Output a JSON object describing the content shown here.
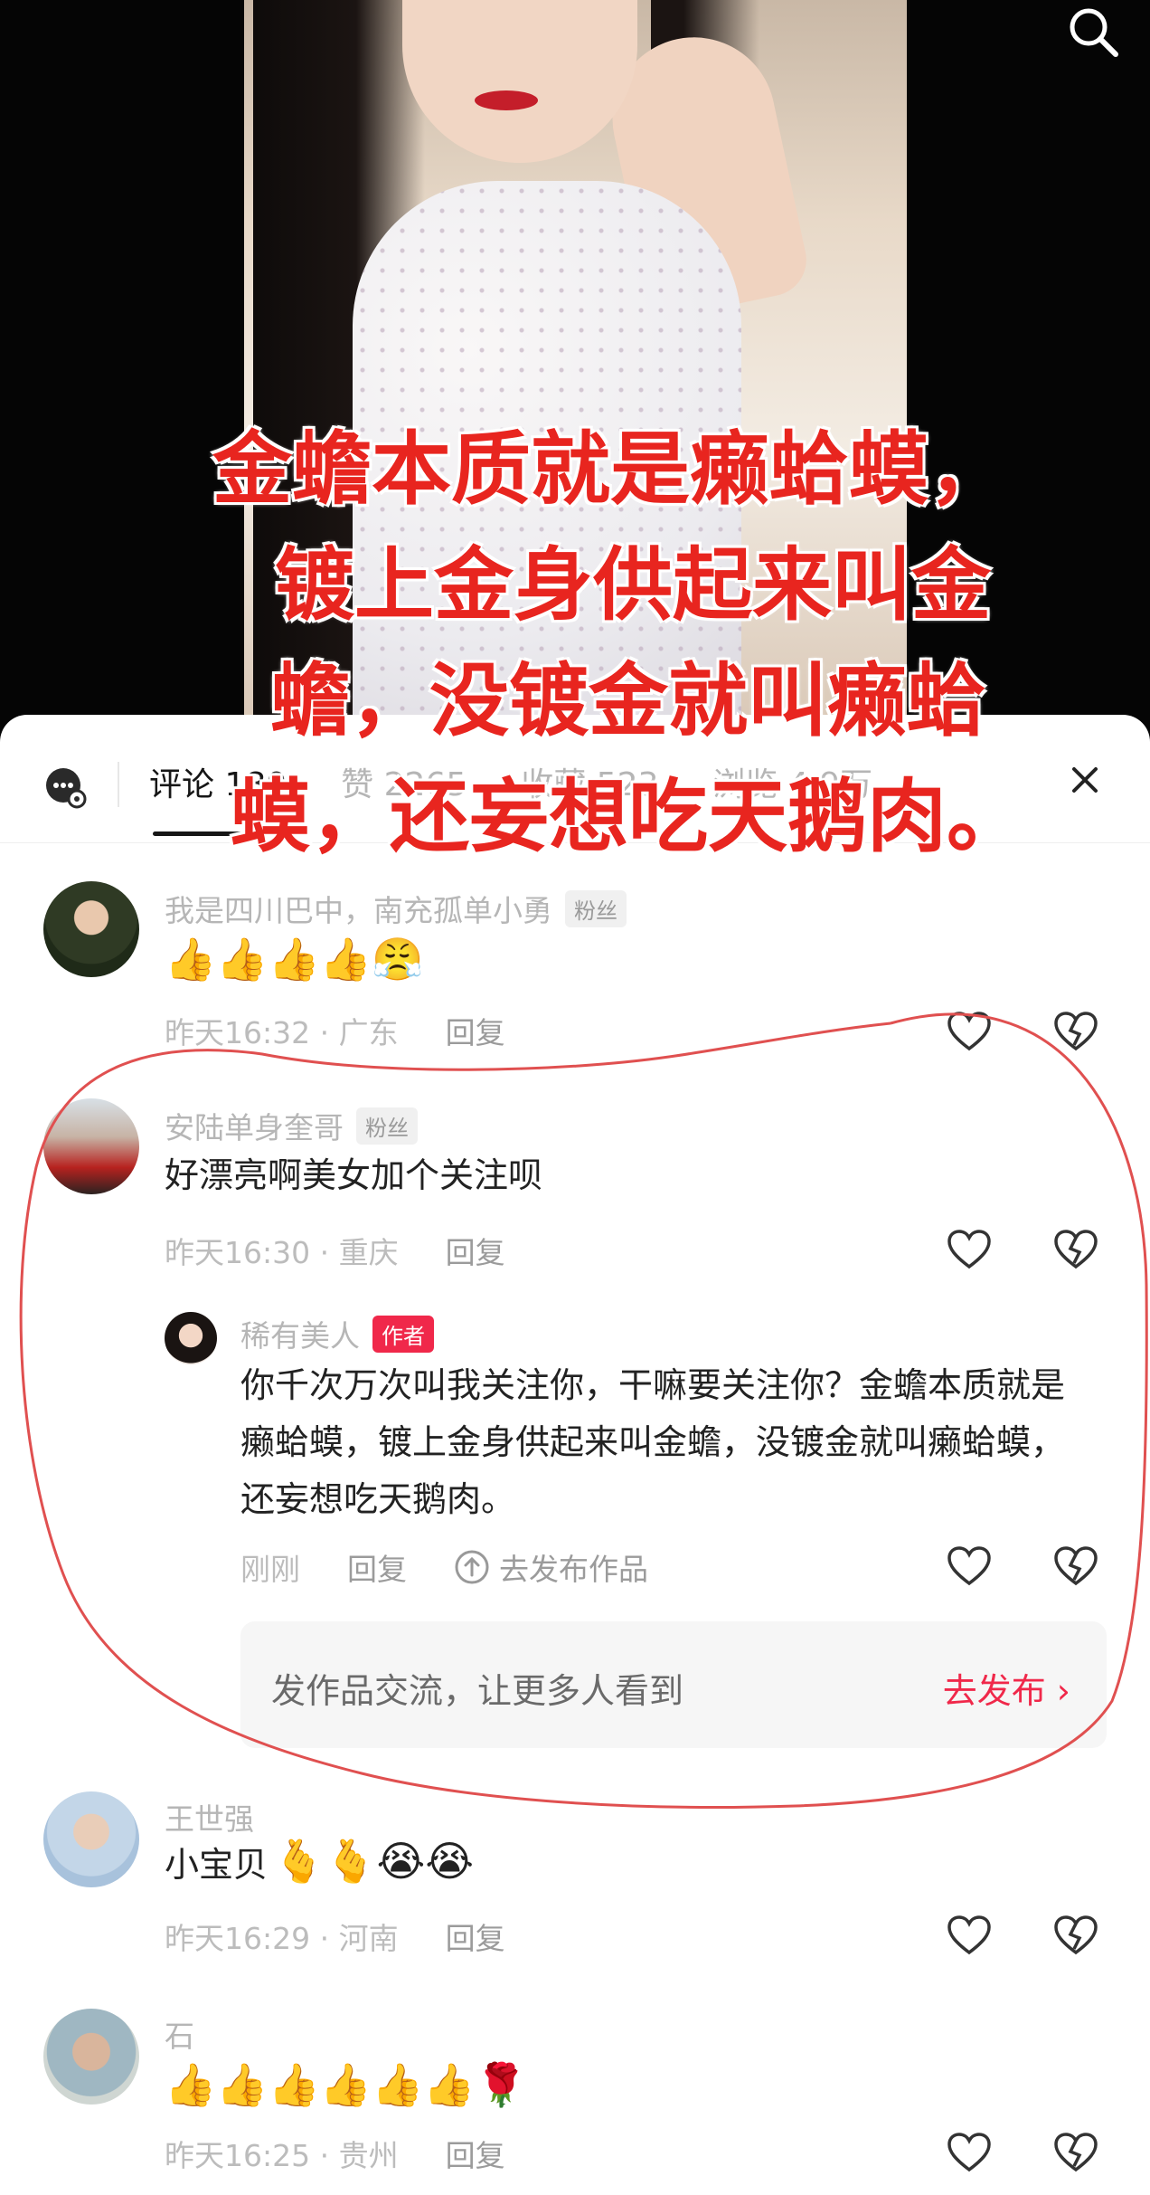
{
  "overlay": {
    "lines": [
      "金蟾本质就是癞蛤蟆，",
      "镀上金身供起来叫金",
      "蟾，没镀金就叫癞蛤",
      "蟆，还妄想吃天鹅肉。"
    ]
  },
  "icons": {
    "search": "search-icon",
    "comment_bubble": "comment-bubble-icon",
    "close": "close-icon",
    "like": "heart-icon",
    "dislike": "broken-heart-icon",
    "publish": "upload-circle-icon"
  },
  "colors": {
    "accent": "#f0284a",
    "overlay_text": "#e8251f",
    "annotation": "#e05050"
  },
  "header": {
    "tabs": [
      {
        "label": "评论 180"
      },
      {
        "label": "赞 2265"
      },
      {
        "label": "收藏 523"
      },
      {
        "label": "浏览 4.9万"
      }
    ]
  },
  "comments": [
    {
      "name": "我是四川巴中，南充孤单小勇",
      "badge": "粉丝",
      "emoji": "👍👍👍👍😤",
      "time": "昨天16:32",
      "location": "广东",
      "reply": "回复"
    },
    {
      "name": "安陆单身奎哥",
      "badge": "粉丝",
      "text": "好漂亮啊美女加个关注呗",
      "time": "昨天16:30",
      "location": "重庆",
      "reply": "回复"
    },
    {
      "name": "王世强",
      "text": "小宝贝",
      "emoji": "🫰🫰😭😭",
      "time": "昨天16:29",
      "location": "河南",
      "reply": "回复"
    },
    {
      "name": "石",
      "emoji": "👍👍👍👍👍👍🌹",
      "time": "昨天16:25",
      "location": "贵州",
      "reply": "回复"
    }
  ],
  "author_reply": {
    "name": "稀有美人",
    "badge": "作者",
    "text": "你千次万次叫我关注你，干嘛要关注你？金蟾本质就是癞蛤蟆，镀上金身供起来叫金蟾，没镀金就叫癞蛤蟆，还妄想吃天鹅肉。",
    "time": "刚刚",
    "reply": "回复",
    "publish": "去发布作品"
  },
  "promo": {
    "text": "发作品交流，让更多人看到",
    "button": "去发布"
  }
}
